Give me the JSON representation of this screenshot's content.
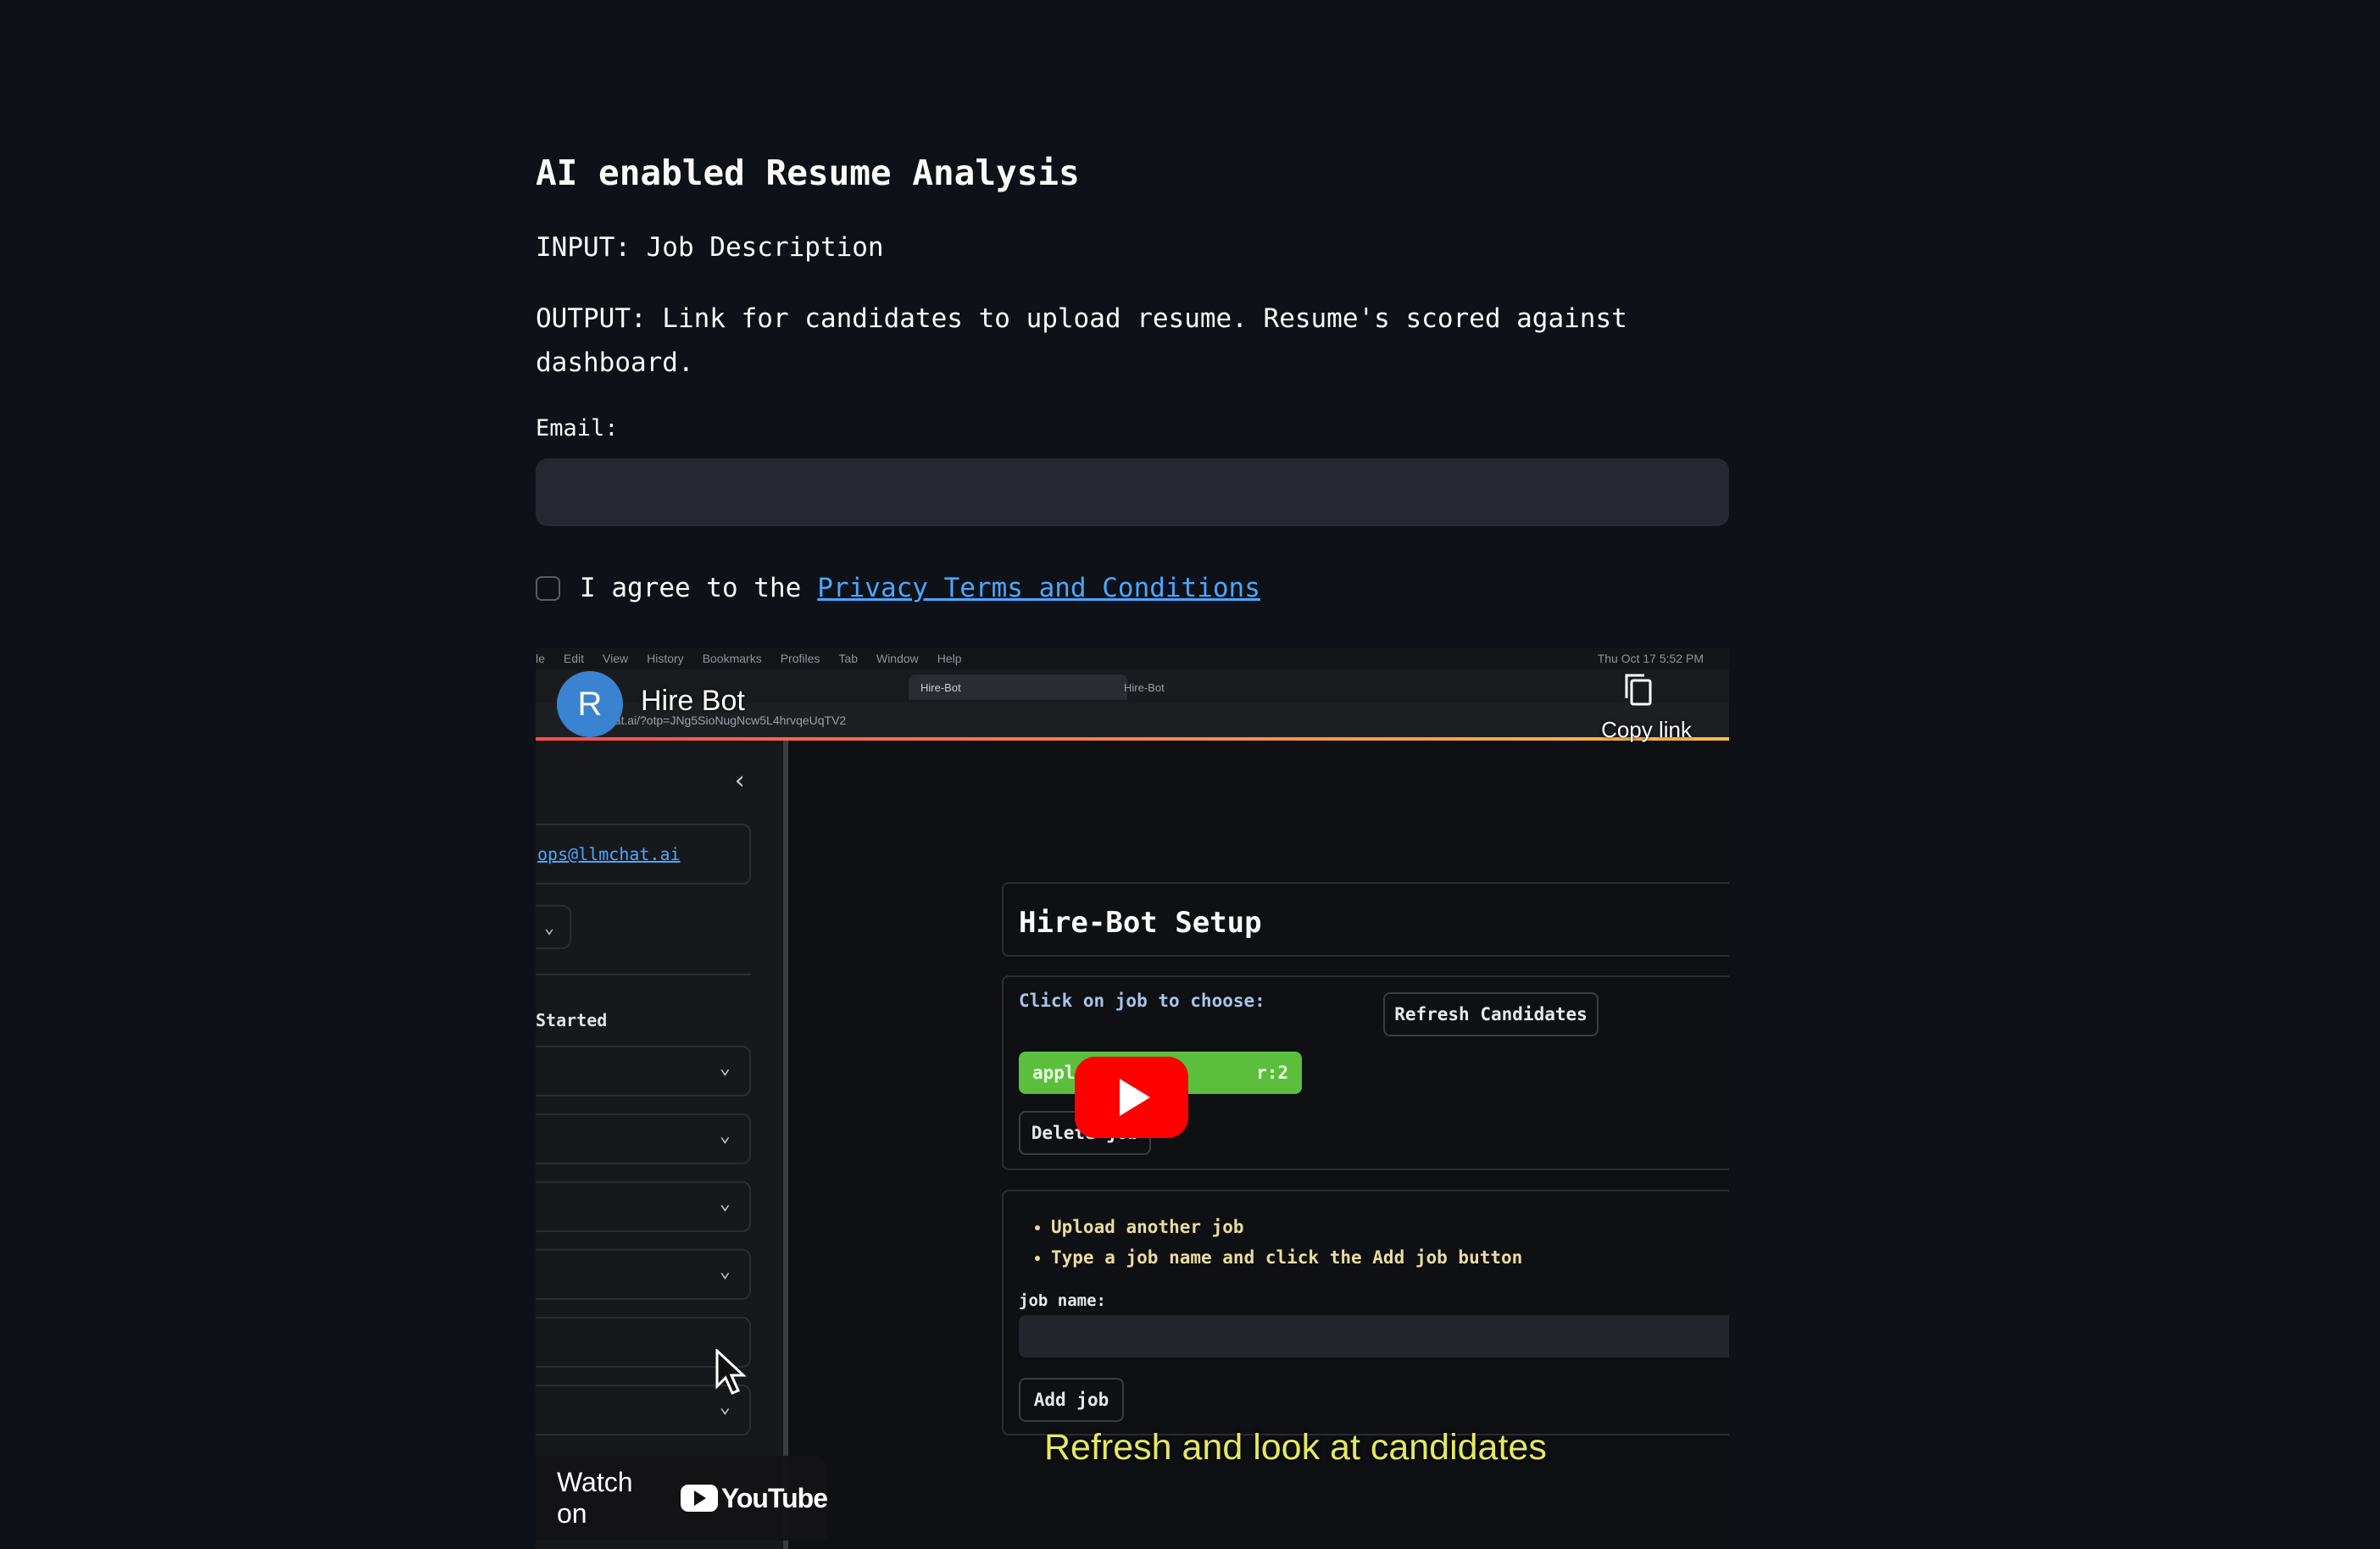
{
  "page": {
    "title": "AI enabled Resume Analysis",
    "input_text": "INPUT: Job Description",
    "output_text": "OUTPUT: Link for candidates to upload resume. Resume's scored against dashboard.",
    "email_label": "Email:",
    "email_value": "",
    "agree_text": "I agree to the",
    "privacy_link": "Privacy Terms and Conditions"
  },
  "video": {
    "channel_initial": "R",
    "channel_title": "Hire Bot",
    "copy_link": "Copy link",
    "watch_on": "Watch on",
    "youtube": "YouTube",
    "caption": "Refresh and look at candidates",
    "screen": {
      "menu_items": [
        "le",
        "Edit",
        "View",
        "History",
        "Bookmarks",
        "Profiles",
        "Tab",
        "Window",
        "Help"
      ],
      "clock": "Thu Oct 17  5:52 PM",
      "tabs": [
        "Hire-Bot",
        "Hire-Bot"
      ],
      "url": "llmchat.ai/?otp=JNg5SioNugNcw5L4hrvqeUqTV2",
      "sidebar_email": "ops@llmchat.ai",
      "sidebar_started": "Started",
      "setup_title": "Hire-Bot Setup",
      "click_label": "Click on job to choose:",
      "refresh_button": "Refresh Candidates",
      "job_pill_start": "apple-softw",
      "job_pill_end": "r:2",
      "delete_button": "Delete job",
      "bullets": [
        "Upload another job",
        "Type a job name and click the Add job button"
      ],
      "job_name_label": "job name:",
      "add_button": "Add job"
    }
  }
}
